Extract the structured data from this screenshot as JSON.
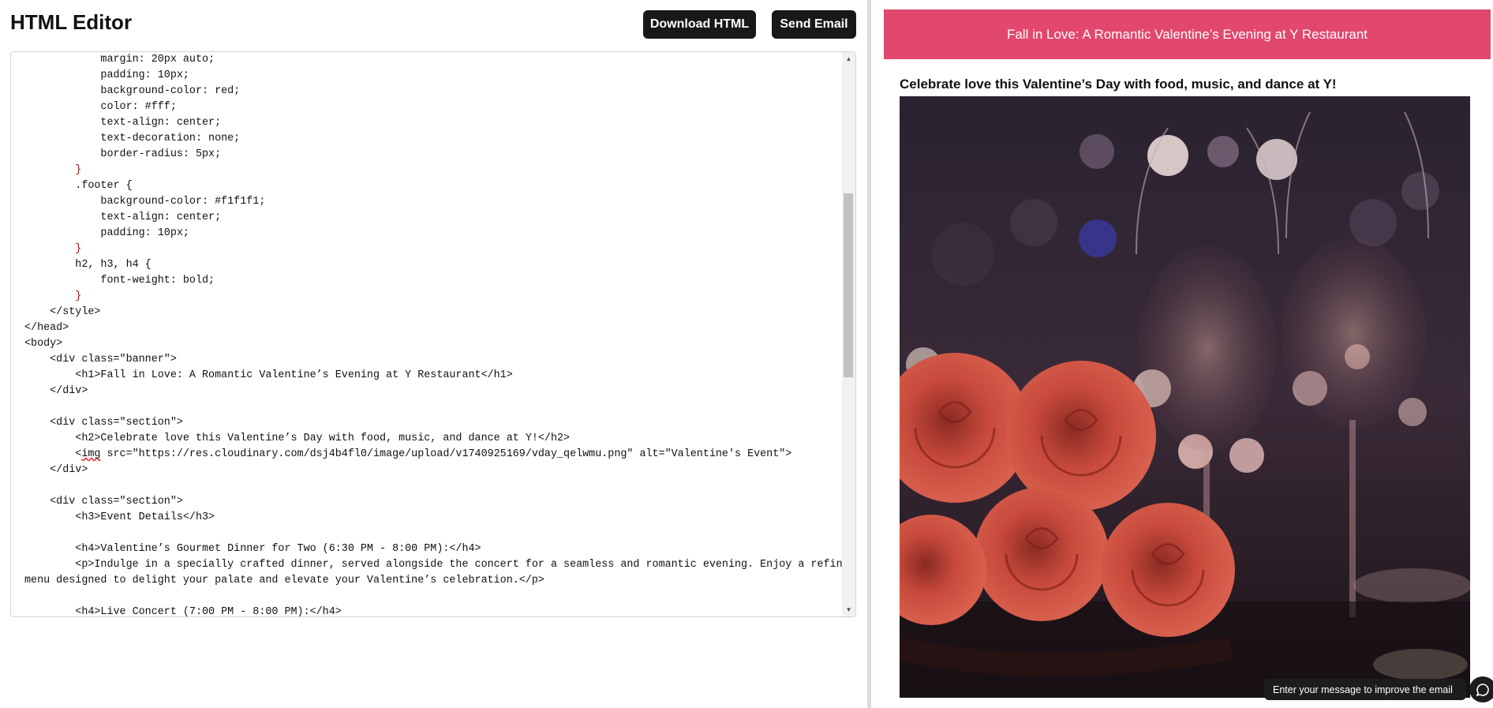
{
  "app": {
    "title": "HTML Editor",
    "download_label": "Download HTML",
    "send_label": "Send Email"
  },
  "editor": {
    "lines": [
      "            margin: 20px auto;",
      "            padding: 10px;",
      "            background-color: red;",
      "            color: #fff;",
      "            text-align: center;",
      "            text-decoration: none;",
      "            border-radius: 5px;",
      "        }",
      "        .footer {",
      "            background-color: #f1f1f1;",
      "            text-align: center;",
      "            padding: 10px;",
      "        }",
      "        h2, h3, h4 {",
      "            font-weight: bold;",
      "        }",
      "    </style>",
      "</head>",
      "<body>",
      "    <div class=\"banner\">",
      "        <h1>Fall in Love: A Romantic Valentine’s Evening at Y Restaurant</h1>",
      "    </div>",
      "",
      "    <div class=\"section\">",
      "        <h2>Celebrate love this Valentine’s Day with food, music, and dance at Y!</h2>",
      "        <img src=\"https://res.cloudinary.com/dsj4b4fl0/image/upload/v1740925169/vday_qelwmu.png\" alt=\"Valentine's Event\">",
      "    </div>",
      "",
      "    <div class=\"section\">",
      "        <h3>Event Details</h3>",
      "",
      "        <h4>Valentine’s Gourmet Dinner for Two (6:30 PM - 8:00 PM):</h4>",
      "        <p>Indulge in a specially crafted dinner, served alongside the concert for a seamless and romantic evening. Enjoy a refined",
      "menu designed to delight your palate and elevate your Valentine’s celebration.</p>",
      "",
      "        <h4>Live Concert (7:00 PM - 8:00 PM):</h4>"
    ],
    "scroll_up_icon": "triangle-up",
    "scroll_down_icon": "triangle-down"
  },
  "preview": {
    "banner_text": "Fall in Love: A Romantic Valentine’s Evening at Y Restaurant",
    "heading": "Celebrate love this Valentine’s Day with food, music, and dance at Y!",
    "image_alt": "Valentine's Event",
    "banner_color": "#e2476d"
  },
  "chat": {
    "placeholder": "Enter your message to improve the email",
    "icon": "chat-bubble-icon"
  }
}
